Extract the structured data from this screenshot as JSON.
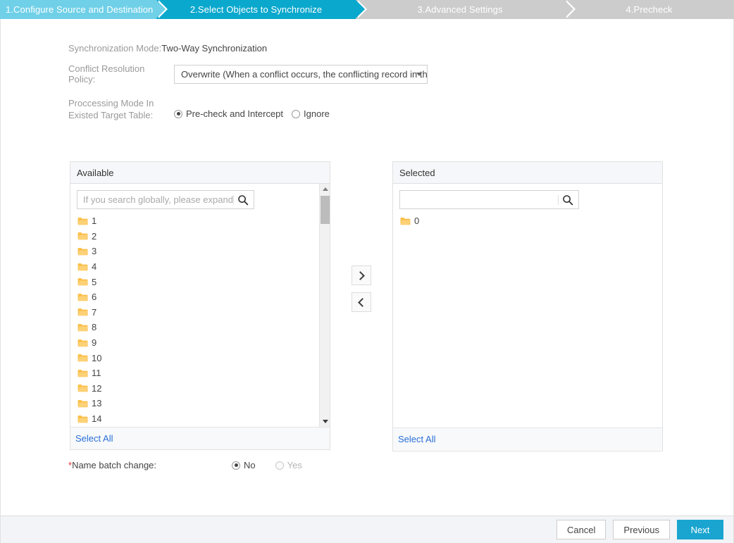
{
  "steps": [
    {
      "label": "1.Configure Source and Destination",
      "state": "done"
    },
    {
      "label": "2.Select Objects to Synchronize",
      "state": "active"
    },
    {
      "label": "3.Advanced Settings",
      "state": "todo"
    },
    {
      "label": "4.Precheck",
      "state": "todo"
    }
  ],
  "form": {
    "sync_mode_label": "Synchronization Mode:",
    "sync_mode_value": "Two-Way Synchronization",
    "policy_label": "Conflict Resolution Policy:",
    "policy_value": "Overwrite (When a conflict occurs, the conflicting record in the",
    "proc_label_line1": "Proccessing Mode In",
    "proc_label_line2": "Existed Target Table:",
    "proc_options": [
      {
        "label": "Pre-check and Intercept",
        "checked": true,
        "disabled": false
      },
      {
        "label": "Ignore",
        "checked": false,
        "disabled": false
      }
    ]
  },
  "available": {
    "title": "Available",
    "search_placeholder": "If you search globally, please expand",
    "items": [
      "1",
      "2",
      "3",
      "4",
      "5",
      "6",
      "7",
      "8",
      "9",
      "10",
      "11",
      "12",
      "13",
      "14"
    ],
    "select_all": "Select All"
  },
  "selected": {
    "title": "Selected",
    "search_placeholder": "",
    "search_value": "",
    "items": [
      "0"
    ],
    "select_all": "Select All"
  },
  "transfer": {
    "move_right": "move-right",
    "move_left": "move-left"
  },
  "batch": {
    "required_mark": "*",
    "label": "Name batch change:",
    "options": [
      {
        "label": "No",
        "checked": true,
        "disabled": false
      },
      {
        "label": "Yes",
        "checked": false,
        "disabled": true
      }
    ]
  },
  "footer": {
    "cancel": "Cancel",
    "previous": "Previous",
    "next": "Next"
  },
  "colors": {
    "step_done": "#6fd0e8",
    "step_active": "#0aa8cd",
    "step_todo": "#cccccc",
    "primary": "#1aa5d0",
    "link": "#2a6fd6",
    "folder": "#fbbf48",
    "required": "#e03131"
  }
}
